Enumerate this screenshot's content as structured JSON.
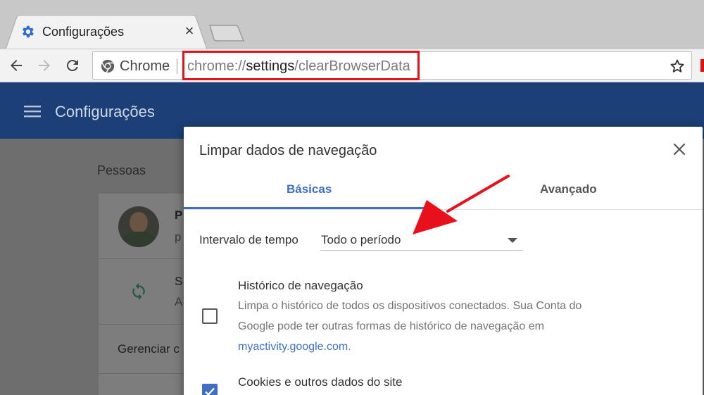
{
  "browser": {
    "tab": {
      "title": "Configurações",
      "favicon": "gear-icon"
    },
    "omnibox": {
      "chip_label": "Chrome",
      "url_scheme": "chrome://",
      "url_host": "settings",
      "url_path": "/clearBrowserData"
    }
  },
  "app": {
    "title": "Configurações"
  },
  "background": {
    "section_title": "Pessoas",
    "profile_initial": "P",
    "profile_sub": "p",
    "sync_initial": "S",
    "sync_sub": "A",
    "manage_label": "Gerenciar c"
  },
  "dialog": {
    "title": "Limpar dados de navegação",
    "tabs": [
      {
        "label": "Básicas",
        "active": true
      },
      {
        "label": "Avançado",
        "active": false
      }
    ],
    "time_range": {
      "label": "Intervalo de tempo",
      "value": "Todo o período"
    },
    "options": [
      {
        "title": "Histórico de navegação",
        "desc_line1": "Limpa o histórico de todos os dispositivos conectados. Sua Conta do",
        "desc_line2": "Google pode ter outras formas de histórico de navegação em",
        "link": "myactivity.google.com",
        "link_suffix": ".",
        "checked": false
      },
      {
        "title": "Cookies e outros dados do site",
        "checked": true
      }
    ]
  },
  "colors": {
    "accent": "#3f6fc5",
    "header": "#1b3f76",
    "highlight": "#e8101b"
  }
}
